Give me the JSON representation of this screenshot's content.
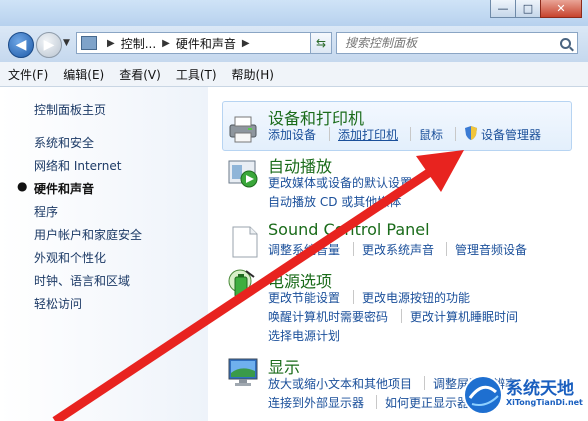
{
  "window": {
    "minimize": "—",
    "maximize": "□",
    "close": "✕"
  },
  "address": {
    "segments": [
      "控制...",
      "硬件和声音"
    ],
    "search_placeholder": "搜索控制面板"
  },
  "menu": [
    "文件(F)",
    "编辑(E)",
    "查看(V)",
    "工具(T)",
    "帮助(H)"
  ],
  "sidebar": {
    "items": [
      "控制面板主页",
      "系统和安全",
      "网络和 Internet",
      "硬件和声音",
      "程序",
      "用户帐户和家庭安全",
      "外观和个性化",
      "时钟、语言和区域",
      "轻松访问"
    ],
    "current_index": 3
  },
  "sections": [
    {
      "title": "设备和打印机",
      "icon": "printer-icon",
      "links": [
        [
          "添加设备",
          "添加打印机",
          "鼠标",
          "设备管理器"
        ]
      ]
    },
    {
      "title": "自动播放",
      "icon": "autoplay-icon",
      "links": [
        [
          "更改媒体或设备的默认设置"
        ],
        [
          "自动播放 CD 或其他媒体"
        ]
      ]
    },
    {
      "title": "Sound Control Panel",
      "icon": "sound-document-icon",
      "links": [
        [
          "调整系统音量",
          "更改系统声音",
          "管理音频设备"
        ]
      ]
    },
    {
      "title": "电源选项",
      "icon": "battery-icon",
      "links": [
        [
          "更改节能设置",
          "更改电源按钮的功能"
        ],
        [
          "唤醒计算机时需要密码",
          "更改计算机睡眠时间"
        ],
        [
          "选择电源计划"
        ]
      ]
    },
    {
      "title": "显示",
      "icon": "display-icon",
      "links": [
        [
          "放大或缩小文本和其他项目",
          "调整屏幕分辨率"
        ],
        [
          "连接到外部显示器",
          "如何更正显示器闪烁"
        ]
      ]
    }
  ],
  "watermark": {
    "title": "系统天地",
    "url": "XiTongTianDi.net"
  },
  "colors": {
    "accent_link": "#1a4f9a",
    "heading_green": "#1a6b1a",
    "arrow_red": "#e8231f"
  }
}
